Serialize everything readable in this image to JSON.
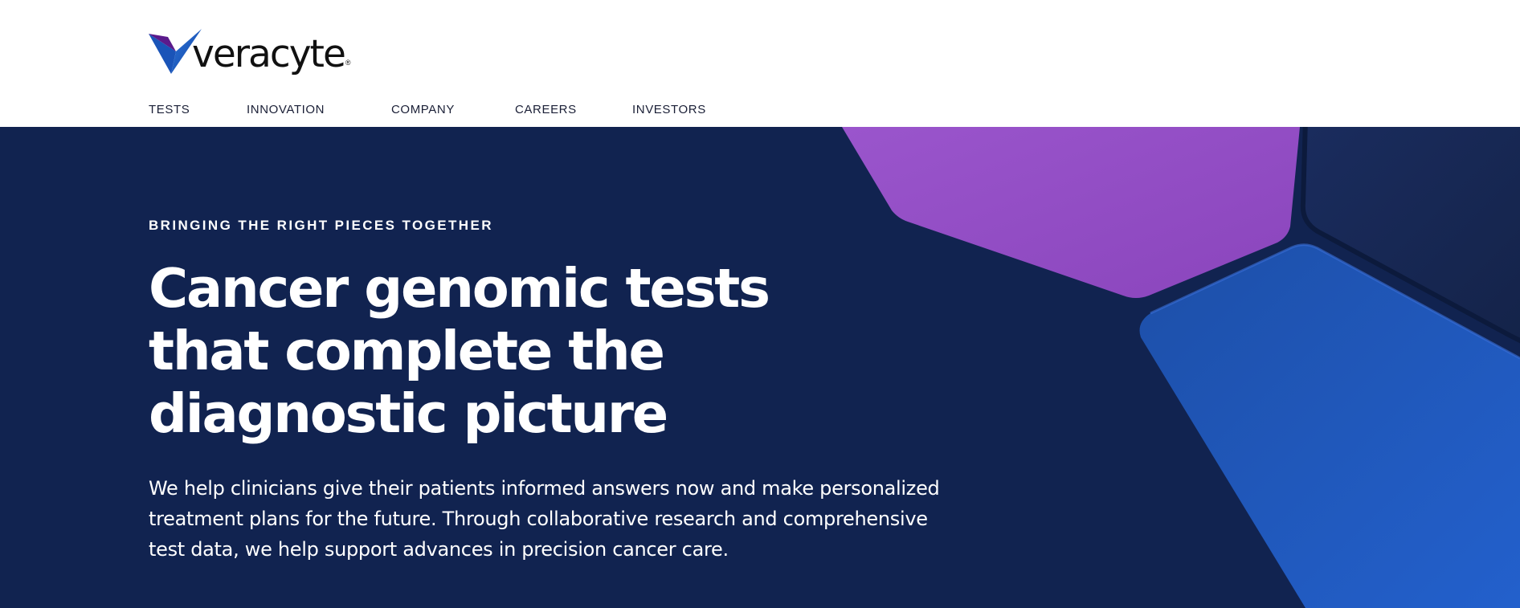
{
  "brand": {
    "name": "veracyte",
    "registered_mark": "®",
    "logo_icon": "veracyte-v-mark-icon",
    "colors": {
      "logo_purple": "#5b1a8c",
      "logo_blue": "#1f5fc4",
      "hero_background": "#112350",
      "shape_purple": "#8f4cc4",
      "shape_blue": "#1f55b5",
      "shape_dark": "#162652"
    }
  },
  "nav": {
    "items": [
      {
        "label": "TESTS"
      },
      {
        "label": "INNOVATION"
      },
      {
        "label": "COMPANY"
      },
      {
        "label": "CAREERS"
      },
      {
        "label": "INVESTORS"
      }
    ]
  },
  "hero": {
    "eyebrow": "BRINGING THE RIGHT PIECES TOGETHER",
    "heading_lines": [
      "Cancer genomic tests",
      "that complete the",
      "diagnostic picture"
    ],
    "body_lines": [
      "We help clinicians give their patients informed answers now and make personalized",
      "treatment plans for the future. Through collaborative research and comprehensive",
      "test data, we help support advances in precision cancer care."
    ]
  }
}
